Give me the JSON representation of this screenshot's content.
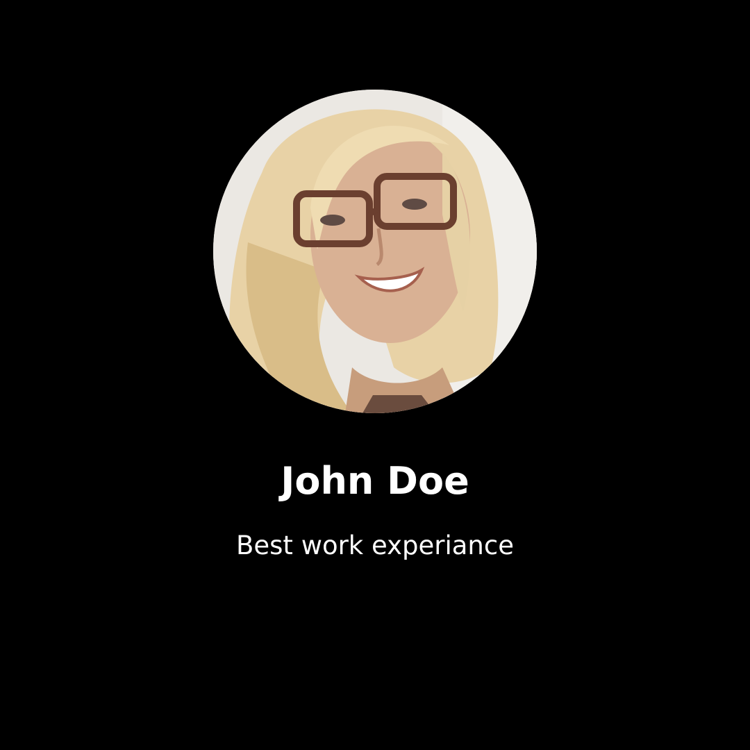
{
  "profile": {
    "name": "John Doe",
    "tagline": "Best work experiance",
    "avatar_icon": "profile-photo"
  },
  "colors": {
    "background": "#000000",
    "text": "#ffffff"
  }
}
